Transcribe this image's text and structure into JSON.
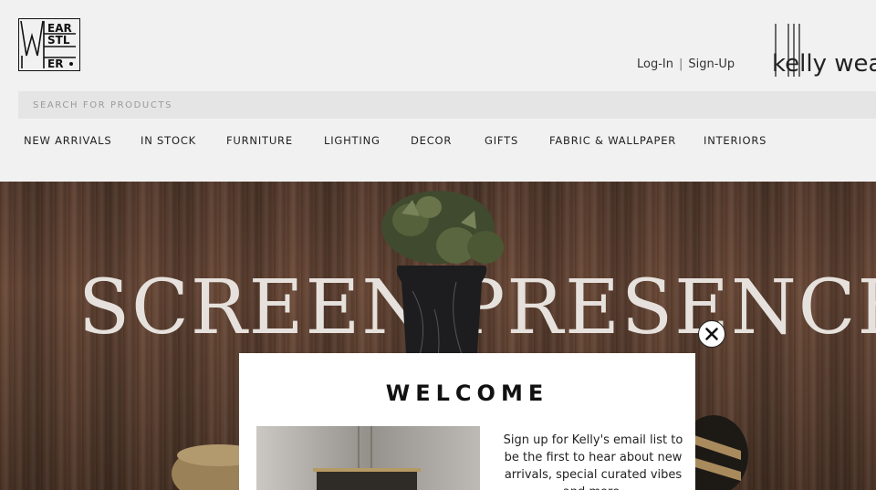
{
  "header": {
    "logo_alt": "WEAR STLER",
    "auth": {
      "login": "Log-In",
      "separator": "|",
      "signup": "Sign-Up"
    },
    "brand": "kelly wearstler",
    "search": {
      "placeholder": "SEARCH FOR PRODUCTS",
      "value": ""
    }
  },
  "nav": {
    "items": [
      "NEW ARRIVALS",
      "IN STOCK",
      "FURNITURE",
      "LIGHTING",
      "DECOR",
      "GIFTS",
      "FABRIC & WALLPAPER",
      "INTERIORS"
    ]
  },
  "hero": {
    "title": "SCREEN PRESENCE"
  },
  "modal": {
    "close_icon": "close-icon",
    "title": "WELCOME",
    "body": "Sign up for Kelly's email list to be the first to hear about new arrivals, special curated vibes and more."
  },
  "colors": {
    "background": "#f1f1f1",
    "wood": "#5e4232",
    "modal": "#ffffff",
    "text": "#222222"
  }
}
